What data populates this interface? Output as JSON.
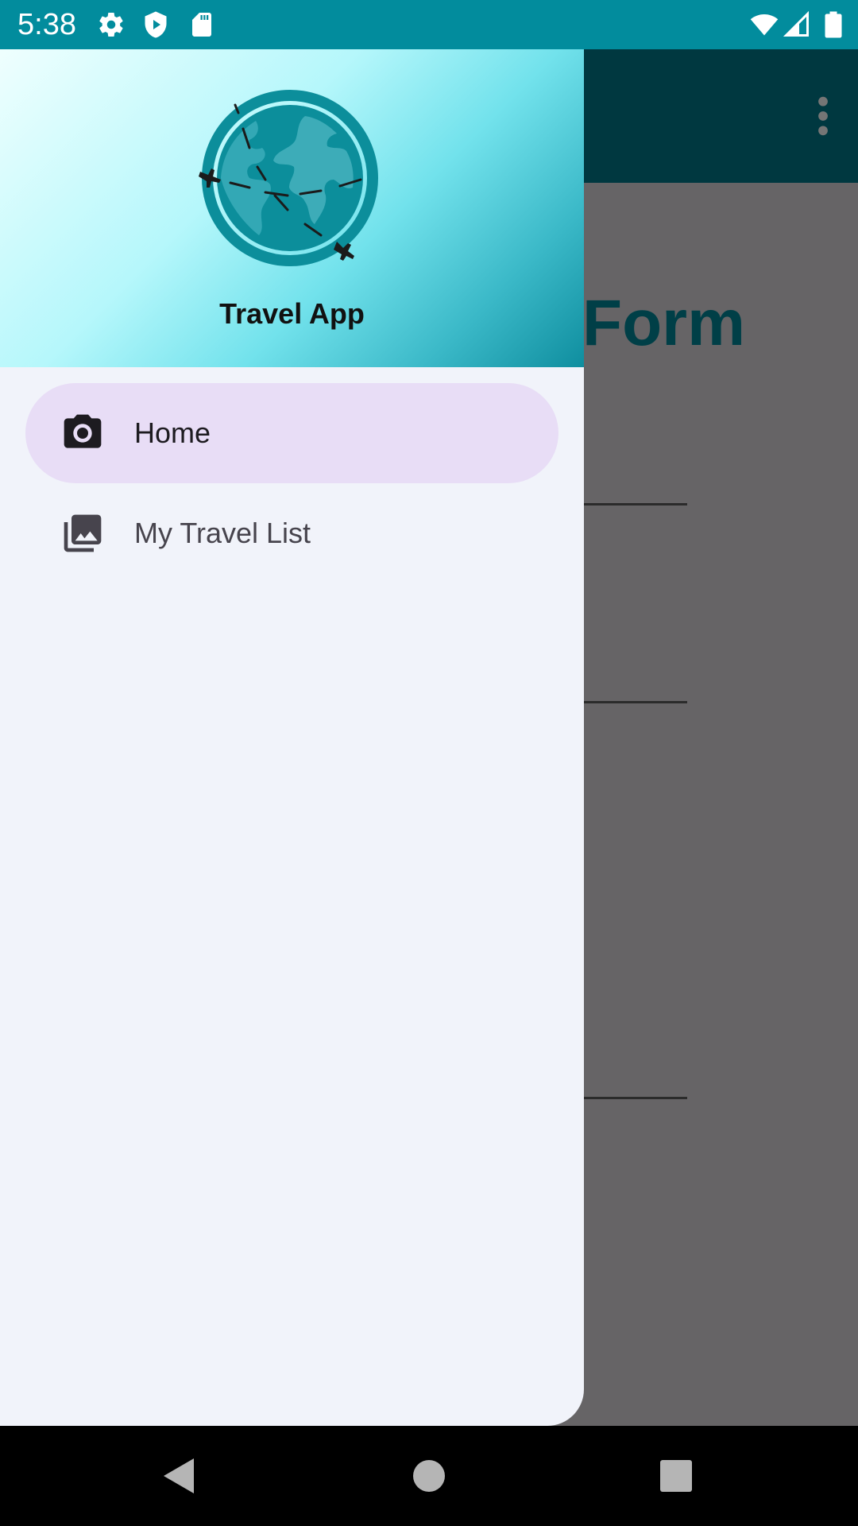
{
  "status_bar": {
    "time": "5:38",
    "icons": [
      "settings-icon",
      "play-protect-icon",
      "sd-card-icon",
      "wifi-icon",
      "cell-signal-icon",
      "battery-icon"
    ]
  },
  "background_app": {
    "title_fragment": "Form",
    "toolbar_color": "#003840",
    "overflow_icon": "more-vert-icon"
  },
  "drawer": {
    "app_name": "Travel App",
    "logo_icon": "globe-travel-icon",
    "items": [
      {
        "label": "Home",
        "icon": "camera-icon",
        "selected": true
      },
      {
        "label": "My Travel List",
        "icon": "photo-library-icon",
        "selected": false
      }
    ]
  },
  "nav_bar": {
    "buttons": [
      "back-icon",
      "home-icon",
      "recents-icon"
    ]
  },
  "colors": {
    "status_bar": "#028c9d",
    "brand_teal": "#0c8e9b",
    "selected_item": "#e8ddf6",
    "drawer_background": "#f1f3fa",
    "scrim": "#666466"
  }
}
